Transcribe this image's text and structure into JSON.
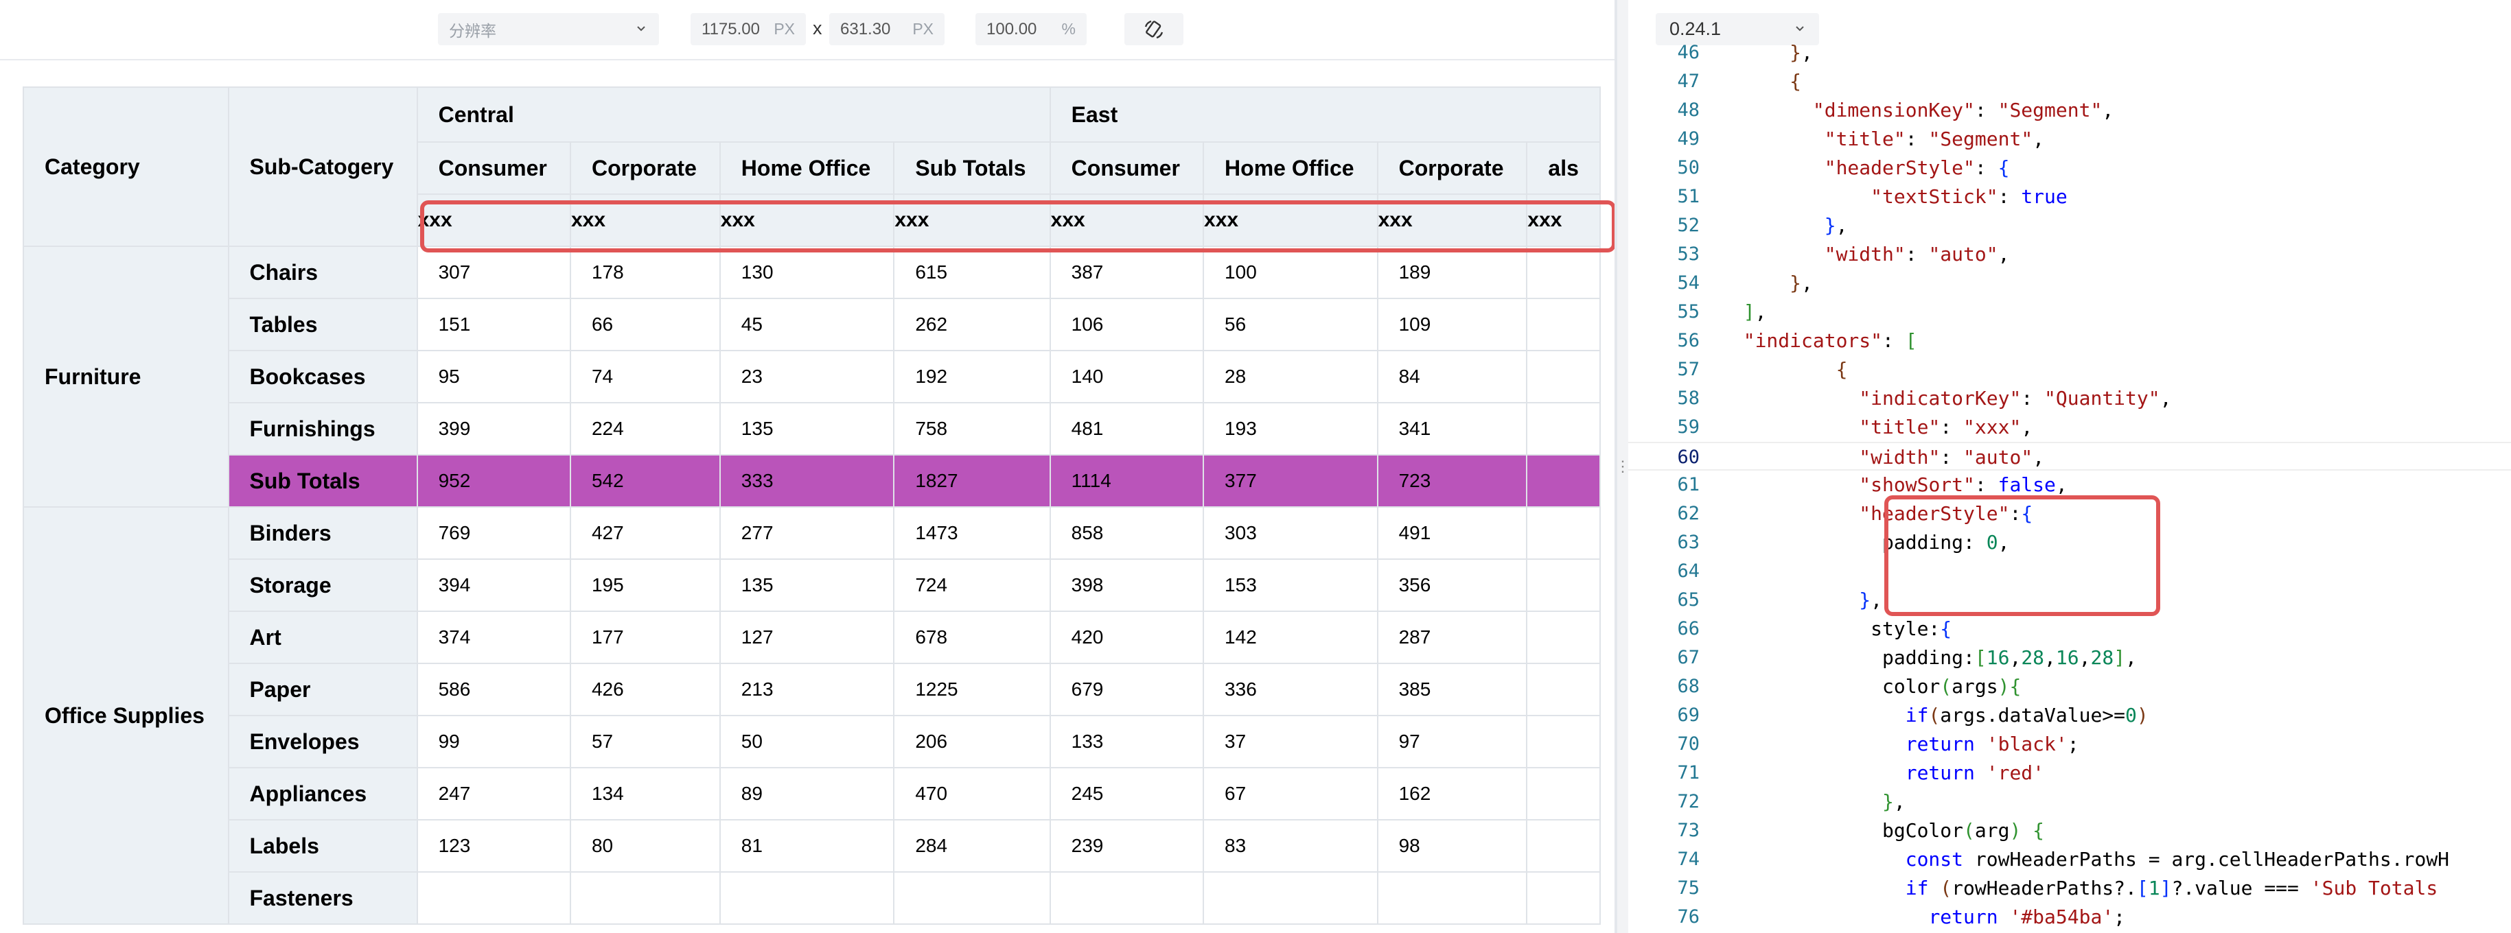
{
  "toolbar": {
    "resolution_placeholder": "分辨率",
    "width_value": "1175.00",
    "width_unit": "PX",
    "times": "x",
    "height_value": "631.30",
    "height_unit": "PX",
    "zoom_value": "100.00",
    "zoom_unit": "%"
  },
  "table": {
    "corner_headers": [
      "Category",
      "Sub-Catogery"
    ],
    "regions": [
      "Central",
      "East"
    ],
    "segments": [
      "Consumer",
      "Corporate",
      "Home Office",
      "Sub Totals",
      "Consumer",
      "Home Office",
      "Corporate",
      "als"
    ],
    "indicators": [
      "xxx",
      "xxx",
      "xxx",
      "xxx",
      "xxx",
      "xxx",
      "xxx",
      "xxx"
    ],
    "categories": [
      "Furniture",
      "Office Supplies"
    ],
    "rows": [
      {
        "sub": "Chairs",
        "values": [
          "307",
          "178",
          "130",
          "615",
          "387",
          "100",
          "189"
        ]
      },
      {
        "sub": "Tables",
        "values": [
          "151",
          "66",
          "45",
          "262",
          "106",
          "56",
          "109"
        ]
      },
      {
        "sub": "Bookcases",
        "values": [
          "95",
          "74",
          "23",
          "192",
          "140",
          "28",
          "84"
        ]
      },
      {
        "sub": "Furnishings",
        "values": [
          "399",
          "224",
          "135",
          "758",
          "481",
          "193",
          "341"
        ]
      },
      {
        "sub": "Sub Totals",
        "values": [
          "952",
          "542",
          "333",
          "1827",
          "1114",
          "377",
          "723"
        ]
      },
      {
        "sub": "Binders",
        "values": [
          "769",
          "427",
          "277",
          "1473",
          "858",
          "303",
          "491"
        ]
      },
      {
        "sub": "Storage",
        "values": [
          "394",
          "195",
          "135",
          "724",
          "398",
          "153",
          "356"
        ]
      },
      {
        "sub": "Art",
        "values": [
          "374",
          "177",
          "127",
          "678",
          "420",
          "142",
          "287"
        ]
      },
      {
        "sub": "Paper",
        "values": [
          "586",
          "426",
          "213",
          "1225",
          "679",
          "336",
          "385"
        ]
      },
      {
        "sub": "Envelopes",
        "values": [
          "99",
          "57",
          "50",
          "206",
          "133",
          "37",
          "97"
        ]
      },
      {
        "sub": "Appliances",
        "values": [
          "247",
          "134",
          "89",
          "470",
          "245",
          "67",
          "162"
        ]
      },
      {
        "sub": "Labels",
        "values": [
          "123",
          "80",
          "81",
          "284",
          "239",
          "83",
          "98"
        ]
      },
      {
        "sub": "Fasteners",
        "values": [
          "",
          "",
          "",
          "",
          "",
          "",
          ""
        ]
      }
    ],
    "subtotal_color": "#ba54ba"
  },
  "editor": {
    "version": "0.24.1",
    "lines": [
      {
        "n": "46",
        "html": "      <span class=\"br3\">}</span>,"
      },
      {
        "n": "47",
        "html": "      <span class=\"br3\">{</span>"
      },
      {
        "n": "48",
        "html": "        <span class=\"k\">\"dimensionKey\"</span>: <span class=\"s\">\"Segment\"</span>,"
      },
      {
        "n": "49",
        "html": "         <span class=\"k\">\"title\"</span>: <span class=\"s\">\"Segment\"</span>,"
      },
      {
        "n": "50",
        "html": "         <span class=\"k\">\"headerStyle\"</span>: <span class=\"br1\">{</span>"
      },
      {
        "n": "51",
        "html": "             <span class=\"k\">\"textStick\"</span>: <span class=\"kw\">true</span>"
      },
      {
        "n": "52",
        "html": "         <span class=\"br1\">}</span>,"
      },
      {
        "n": "53",
        "html": "         <span class=\"k\">\"width\"</span>: <span class=\"s\">\"auto\"</span>,"
      },
      {
        "n": "54",
        "html": "      <span class=\"br3\">}</span>,"
      },
      {
        "n": "55",
        "html": "  <span class=\"br2\">]</span>,"
      },
      {
        "n": "56",
        "html": "  <span class=\"k\">\"indicators\"</span>: <span class=\"br2\">[</span>"
      },
      {
        "n": "57",
        "html": "          <span class=\"br3\">{</span>"
      },
      {
        "n": "58",
        "html": "            <span class=\"k\">\"indicatorKey\"</span>: <span class=\"s\">\"Quantity\"</span>,"
      },
      {
        "n": "59",
        "html": "            <span class=\"k\">\"title\"</span>: <span class=\"s\">\"xxx\"</span>,"
      },
      {
        "n": "60",
        "html": "            <span class=\"k\">\"width\"</span>: <span class=\"s\">\"auto\"</span>,"
      },
      {
        "n": "61",
        "html": "            <span class=\"k\">\"showSort\"</span>: <span class=\"kw\">false</span>,"
      },
      {
        "n": "62",
        "html": "            <span class=\"k\">\"headerStyle\"</span>:<span class=\"br1\">{</span>"
      },
      {
        "n": "63",
        "html": "              padding: <span class=\"n\">0</span>,"
      },
      {
        "n": "64",
        "html": ""
      },
      {
        "n": "65",
        "html": "            <span class=\"br1\">}</span>,"
      },
      {
        "n": "66",
        "html": "             style:<span class=\"br1\">{</span>"
      },
      {
        "n": "67",
        "html": "              padding:<span class=\"br2\">[</span><span class=\"n\">16</span>,<span class=\"n\">28</span>,<span class=\"n\">16</span>,<span class=\"n\">28</span><span class=\"br2\">]</span>,"
      },
      {
        "n": "68",
        "html": "              color<span class=\"br2\">(</span>args<span class=\"br2\">)</span><span class=\"br2\">{</span>"
      },
      {
        "n": "69",
        "html": "                <span class=\"kw\">if</span><span class=\"br3\">(</span>args.dataValue>=<span class=\"n\">0</span><span class=\"br3\">)</span>"
      },
      {
        "n": "70",
        "html": "                <span class=\"kw\">return</span> <span class=\"s\">'black'</span>;"
      },
      {
        "n": "71",
        "html": "                <span class=\"kw\">return</span> <span class=\"s\">'red'</span>"
      },
      {
        "n": "72",
        "html": "              <span class=\"br2\">}</span>,"
      },
      {
        "n": "73",
        "html": "              bgColor<span class=\"br2\">(</span>arg<span class=\"br2\">)</span> <span class=\"br2\">{</span>"
      },
      {
        "n": "74",
        "html": "                <span class=\"kw\">const</span> rowHeaderPaths = arg.cellHeaderPaths.rowH"
      },
      {
        "n": "75",
        "html": "                <span class=\"kw\">if</span> <span class=\"br3\">(</span>rowHeaderPaths?.<span class=\"br1\">[</span><span class=\"n\">1</span><span class=\"br1\">]</span>?.value === <span class=\"s\">'Sub Totals</span>"
      },
      {
        "n": "76",
        "html": "                  <span class=\"kw\">return</span> <span class=\"s\">'#ba54ba'</span>;"
      }
    ],
    "active_line": "60"
  }
}
